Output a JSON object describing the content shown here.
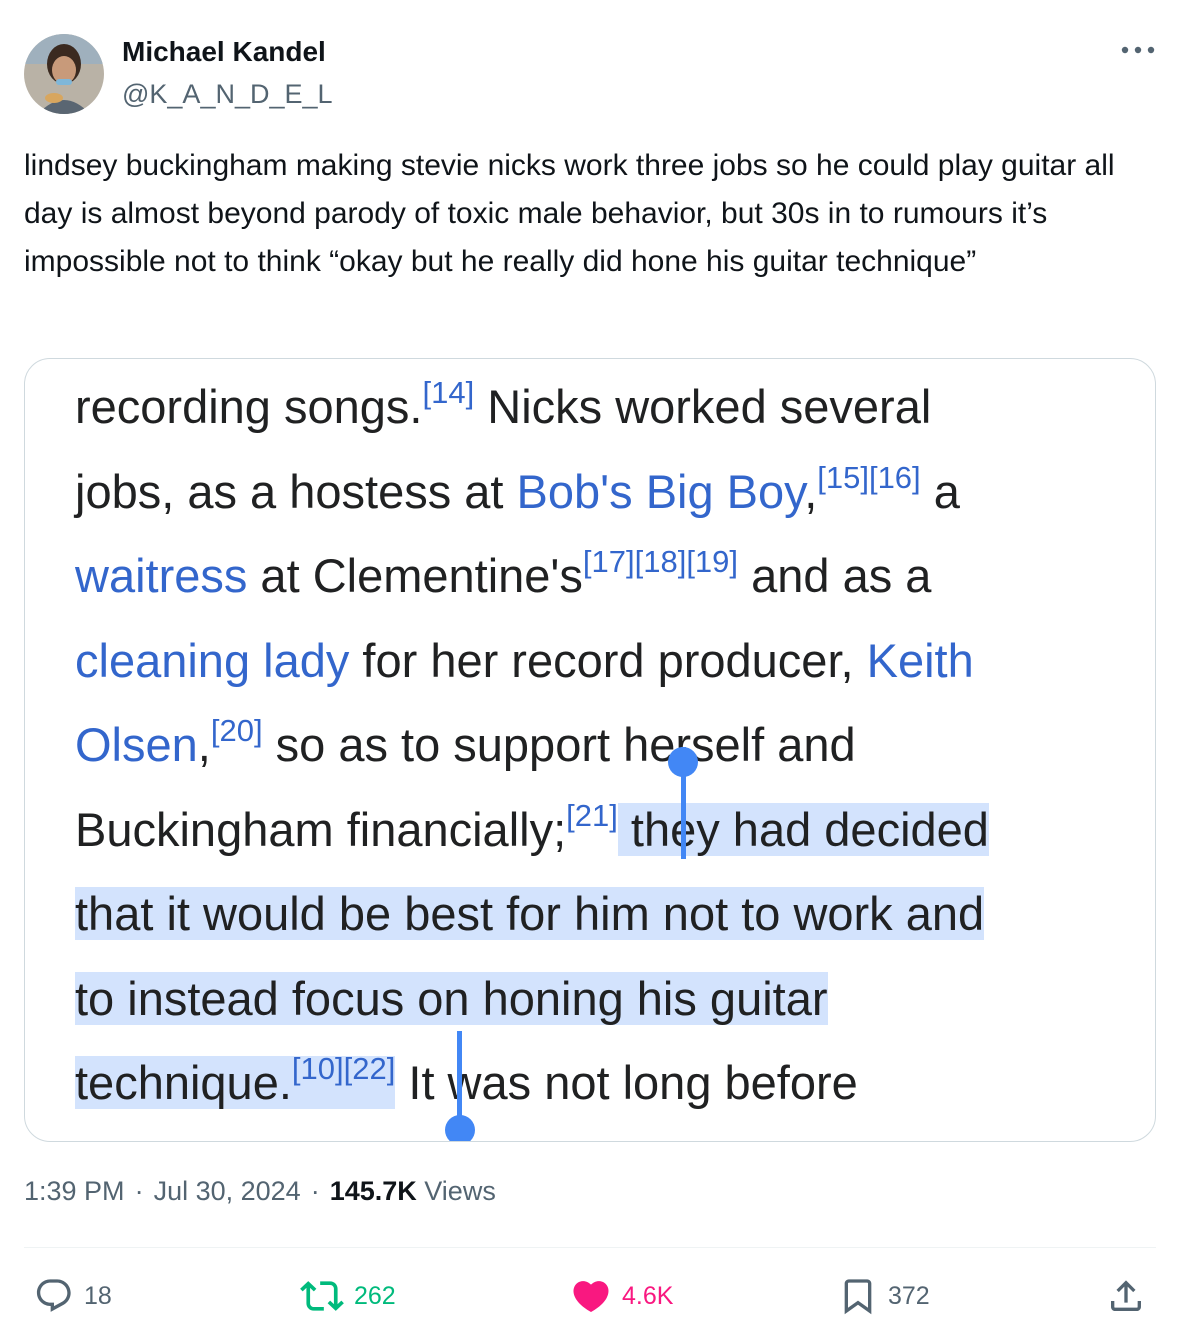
{
  "author": {
    "display_name": "Michael Kandel",
    "handle": "@K_A_N_D_E_L"
  },
  "tweet": {
    "text": "lindsey buckingham making stevie nicks work three jobs so he could play guitar all day is almost beyond parody of toxic male behavior, but 30s in to rumours it’s impossible not to think “okay but he really did hone his guitar technique”"
  },
  "media": {
    "lines": [
      {
        "a": "recording songs.",
        "r1": "[14]",
        "b": " Nicks worked several"
      },
      {
        "a": "jobs, as a hostess at ",
        "l1": "Bob's Big Boy",
        "b": ",",
        "r1": "[15][16]",
        "c": " a"
      },
      {
        "l1": "waitress",
        "a": " at Clementine's",
        "r1": "[17][18][19]",
        "b": " and as a"
      },
      {
        "l1": "cleaning lady",
        "a": " for her record producer, ",
        "l2": "Keith"
      },
      {
        "l1": "Olsen",
        "a": ",",
        "r1": "[20]",
        "b": " so as to support herself and"
      },
      {
        "a": "Buckingham financially;",
        "r1": "[21]",
        "s": " they had decided"
      },
      {
        "s": "that it would be best for him not to work and"
      },
      {
        "s": "to instead focus on honing his guitar"
      },
      {
        "s": "technique.",
        "r1": "[10][22]",
        "b": " It was not long before"
      }
    ]
  },
  "meta": {
    "time": "1:39 PM",
    "date": "Jul 30, 2024",
    "views_count": "145.7K",
    "views_label": "Views",
    "dot": "·"
  },
  "actions": {
    "replies": "18",
    "reposts": "262",
    "likes": "4.6K",
    "bookmarks": "372"
  },
  "colors": {
    "link_blue": "#3366cc",
    "selection": "#d3e3fd",
    "repost_green": "#00ba7c",
    "like_pink": "#f91880",
    "muted": "#536471"
  }
}
